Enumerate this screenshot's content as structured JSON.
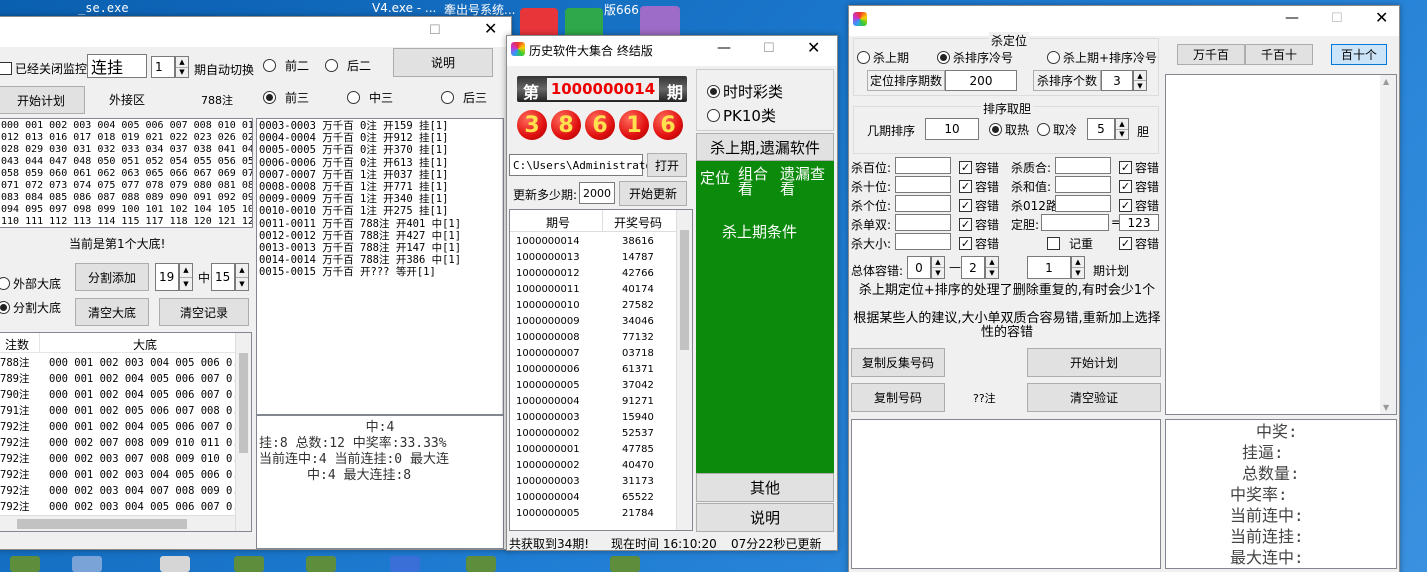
{
  "desktop": {
    "labels": [
      "_se.exe",
      "V4.exe - ...",
      "牽出号系统...",
      "版666.rar"
    ]
  },
  "w1": {
    "chk_monitor": "已经关闭监控",
    "mode": "连挂",
    "count": "1",
    "auto_switch": "期自动切换",
    "r_front2": "前二",
    "r_back2": "后二",
    "btn_help": "说明",
    "btn_start": "开始计划",
    "lbl_area": "外接区",
    "lbl_bets": "788注",
    "r_front3": "前三",
    "r_mid3": "中三",
    "r_back3": "后三",
    "numgrid": [
      "000 001 002 003 004 005 006 007 008 010 011",
      "012 013 016 017 018 019 021 022 023 026 027",
      "028 029 030 031 032 033 034 037 038 041 042",
      "043 044 047 048 050 051 052 054 055 056 057",
      "058 059 060 061 062 063 065 066 067 069 070",
      "071 072 073 074 075 077 078 079 080 081 082",
      "083 084 085 086 087 088 089 090 091 092 093",
      "094 095 097 098 099 100 101 102 104 105 109",
      "110 111 112 113 114 115 117 118 120 121 122"
    ],
    "log": [
      "0003-0003 万千百 0注 开159 挂[1]",
      "0004-0004 万千百 0注 开912 挂[1]",
      "0005-0005 万千百 0注 开370 挂[1]",
      "0006-0006 万千百 0注 开613 挂[1]",
      "0007-0007 万千百 1注 开037 挂[1]",
      "0008-0008 万千百 1注 开771 挂[1]",
      "0009-0009 万千百 1注 开340 挂[1]",
      "0010-0010 万千百 1注 开275 挂[1]",
      "0011-0011 万千百 788注 开401 中[1]",
      "0012-0012 万千百 788注 开427 中[1]",
      "0013-0013 万千百 788注 开147 中[1]",
      "0014-0014 万千百 788注 开386 中[1]",
      "0015-0015 万千百 开??? 等开[1]"
    ],
    "current": "当前是第1个大底!",
    "r_external": "外部大底",
    "r_split": "分割大底",
    "btn_split_add": "分割添加",
    "split_a": "19",
    "mid": "中",
    "split_b": "15",
    "btn_clear_base": "清空大底",
    "btn_clear_rec": "清空记录",
    "tbl_head": [
      "注数",
      "大底"
    ],
    "tbl_rows": [
      [
        "788注",
        "000 001 002 003 004 005 006 0..."
      ],
      [
        "789注",
        "000 001 002 004 005 006 007 0..."
      ],
      [
        "790注",
        "000 001 002 004 005 006 007 0..."
      ],
      [
        "791注",
        "000 001 002 005 006 007 008 0..."
      ],
      [
        "792注",
        "000 001 002 004 005 006 007 0..."
      ],
      [
        "792注",
        "000 002 007 008 009 010 011 0..."
      ],
      [
        "792注",
        "000 002 003 007 008 009 010 0..."
      ],
      [
        "792注",
        "000 001 002 003 004 005 006 0..."
      ],
      [
        "792注",
        "000 002 003 004 007 008 009 0..."
      ],
      [
        "792注",
        "000 002 003 004 005 006 007 0..."
      ],
      [
        "791注",
        "000 001 002 003 004 005 006 0..."
      ],
      [
        "790注",
        "000 001 002 004 005 006 007 0..."
      ],
      [
        "789注",
        "001 002 003 004 005 006 007 0..."
      ]
    ],
    "stats": [
      "中:4",
      "挂:8 总数:12 中奖率:33.33%",
      "当前连中:4 当前连挂:0 最大连",
      "中:4 最大连挂:8"
    ]
  },
  "w2": {
    "title": "历史软件大集合 终结版",
    "issue_pre": "第",
    "issue": "1000000014",
    "issue_suf": "期",
    "balls": [
      "3",
      "8",
      "6",
      "1",
      "6"
    ],
    "r_time": "时时彩类",
    "r_pk10": "PK10类",
    "btn_kill": "杀上期,遗漏软件",
    "path": "C:\\Users\\Administrator",
    "btn_open": "打开",
    "lbl_update": "更新多少期:",
    "update_n": "2000",
    "btn_update": "开始更新",
    "green_tabs": [
      "定位",
      "组合看",
      "遗漏查看"
    ],
    "green_sub": "杀上期条件",
    "btn_other": "其他",
    "btn_help": "说明",
    "col_issue": "期号",
    "col_num": "开奖号码",
    "rows": [
      [
        "1000000014",
        "38616"
      ],
      [
        "1000000013",
        "14787"
      ],
      [
        "1000000012",
        "42766"
      ],
      [
        "1000000011",
        "40174"
      ],
      [
        "1000000010",
        "27582"
      ],
      [
        "1000000009",
        "34046"
      ],
      [
        "1000000008",
        "77132"
      ],
      [
        "1000000007",
        "03718"
      ],
      [
        "1000000006",
        "61371"
      ],
      [
        "1000000005",
        "37042"
      ],
      [
        "1000000004",
        "91271"
      ],
      [
        "1000000003",
        "15940"
      ],
      [
        "1000000002",
        "52537"
      ],
      [
        "1000000001",
        "47785"
      ],
      [
        "1000000002",
        "40470"
      ],
      [
        "1000000003",
        "31173"
      ],
      [
        "1000000004",
        "65522"
      ],
      [
        "1000000005",
        "21784"
      ]
    ],
    "status": [
      "共获取到34期!",
      "现在时间 16:10:20",
      "07分22秒已更新"
    ]
  },
  "w3": {
    "g_kill": "杀定位",
    "r_kill_prev": "杀上期",
    "r_kill_sort": "杀排序冷号",
    "r_kill_both": "杀上期+排序冷号",
    "btn_wqb": "万千百",
    "btn_qbs": "千百十",
    "btn_bsg": "百十个",
    "lbl_sort_n": "定位排序期数",
    "sort_n": "200",
    "lbl_kill_cnt": "杀排序个数",
    "kill_cnt": "3",
    "g_sort": "排序取胆",
    "lbl_jiqi": "几期排序",
    "jiqi": "10",
    "r_hot": "取热",
    "r_cold": "取冷",
    "dan_n": "5",
    "lbl_dan": "胆",
    "rows": [
      {
        "a": "杀百位:",
        "b": "杀质合:"
      },
      {
        "a": "杀十位:",
        "b": "杀和值:"
      },
      {
        "a": "杀个位:",
        "b": "杀012路:"
      },
      {
        "a": "杀单双:",
        "b": "定胆:"
      },
      {
        "a": "杀大小:",
        "b": ""
      }
    ],
    "tol": "容错",
    "dan_val": "123",
    "eq": "=",
    "remember": "记重",
    "lbl_total_tol": "总体容错:",
    "tol_a": "0",
    "dash": "—",
    "tol_b": "2",
    "plan_n": "1",
    "lbl_plan": "期计划",
    "note1": "杀上期定位+排序的处理了删除重复的,有时会少1个",
    "note2": "根据某些人的建议,大小单双质合容易错,重新加上选择性的容错",
    "btn_copy_rev": "复制反集号码",
    "btn_plan": "开始计划",
    "btn_copy": "复制号码",
    "bets": "??注",
    "btn_clear": "清空验证",
    "stats": [
      "中奖:",
      "挂逼:",
      "总数量:",
      "中奖率:",
      "当前连中:",
      "当前连挂:",
      "最大连中:",
      "最大连挂:"
    ]
  }
}
